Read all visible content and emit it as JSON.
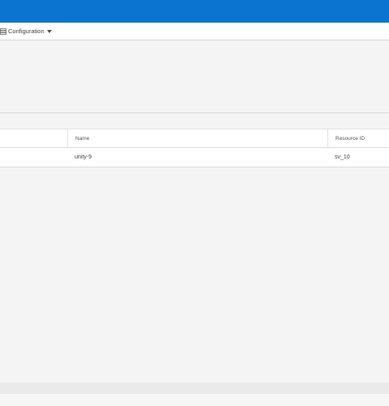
{
  "toolbar": {
    "config_label": "Configuration",
    "config_icon": "server-config-icon"
  },
  "table": {
    "columns": [
      "",
      "Name",
      "Resource ID"
    ],
    "rows": [
      {
        "lead": "",
        "name": "unity-9",
        "resource_id": "sv_10"
      }
    ]
  },
  "colors": {
    "topbar": "#0a74d0",
    "background": "#f4f4f4"
  }
}
